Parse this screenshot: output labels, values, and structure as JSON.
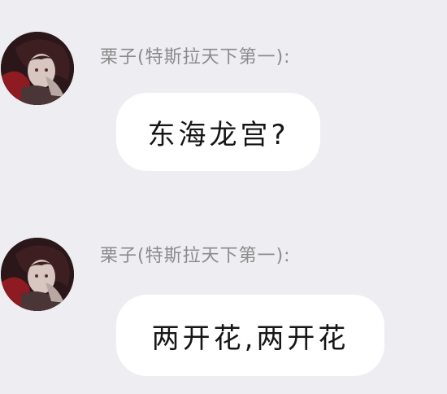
{
  "messages": [
    {
      "sender": "栗子(特斯拉天下第一):",
      "text": "东海龙宫?"
    },
    {
      "sender": "栗子(特斯拉天下第一):",
      "text": "两开花,两开花"
    }
  ]
}
